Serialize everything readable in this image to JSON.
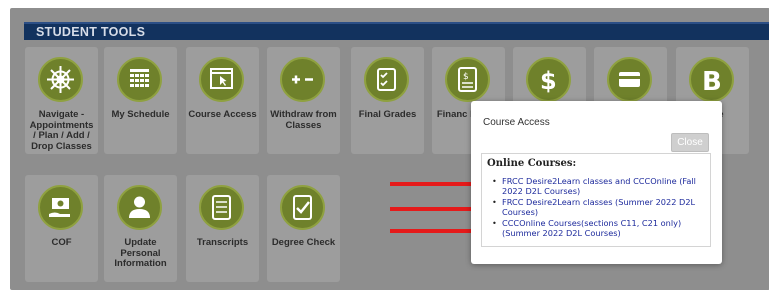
{
  "header": {
    "title": "STUDENT TOOLS"
  },
  "tiles_row1": [
    {
      "label": "Navigate - Appointments / Plan / Add / Drop Classes",
      "icon": "ship-wheel-icon"
    },
    {
      "label": "My Schedule",
      "icon": "calendar-icon"
    },
    {
      "label": "Course Access",
      "icon": "cursor-window-icon"
    },
    {
      "label": "Withdraw from Classes",
      "icon": "plus-minus-icon"
    },
    {
      "label": "Final Grades",
      "icon": "checklist-icon"
    },
    {
      "label": "Financ Requir",
      "icon": "money-document-icon"
    },
    {
      "label": "",
      "icon": "dollar-icon"
    },
    {
      "label": "",
      "icon": "credit-card-icon"
    },
    {
      "label": "obile",
      "icon": "letter-b-icon"
    }
  ],
  "tiles_row2": [
    {
      "label": "COF",
      "icon": "money-hand-icon"
    },
    {
      "label": "Update Personal Information",
      "icon": "person-icon"
    },
    {
      "label": "Transcripts",
      "icon": "document-icon"
    },
    {
      "label": "Degree Check",
      "icon": "check-document-icon"
    }
  ],
  "modal": {
    "title": "Course Access",
    "close_label": "Close",
    "heading": "Online Courses:",
    "links": [
      "FRCC Desire2Learn classes and CCCOnline (Fall 2022 D2L Courses)",
      "FRCC Desire2Learn classes (Summer 2022 D2L Courses)",
      "CCCOnline Courses(sections C11, C21 only) (Summer 2022 D2L Courses)"
    ]
  },
  "colors": {
    "header_bg": "#12325e",
    "tile_bg": "#9d9d9d",
    "icon_circle": "#6f812b",
    "arrow": "#e51a1a",
    "link": "#1d2a9c"
  }
}
